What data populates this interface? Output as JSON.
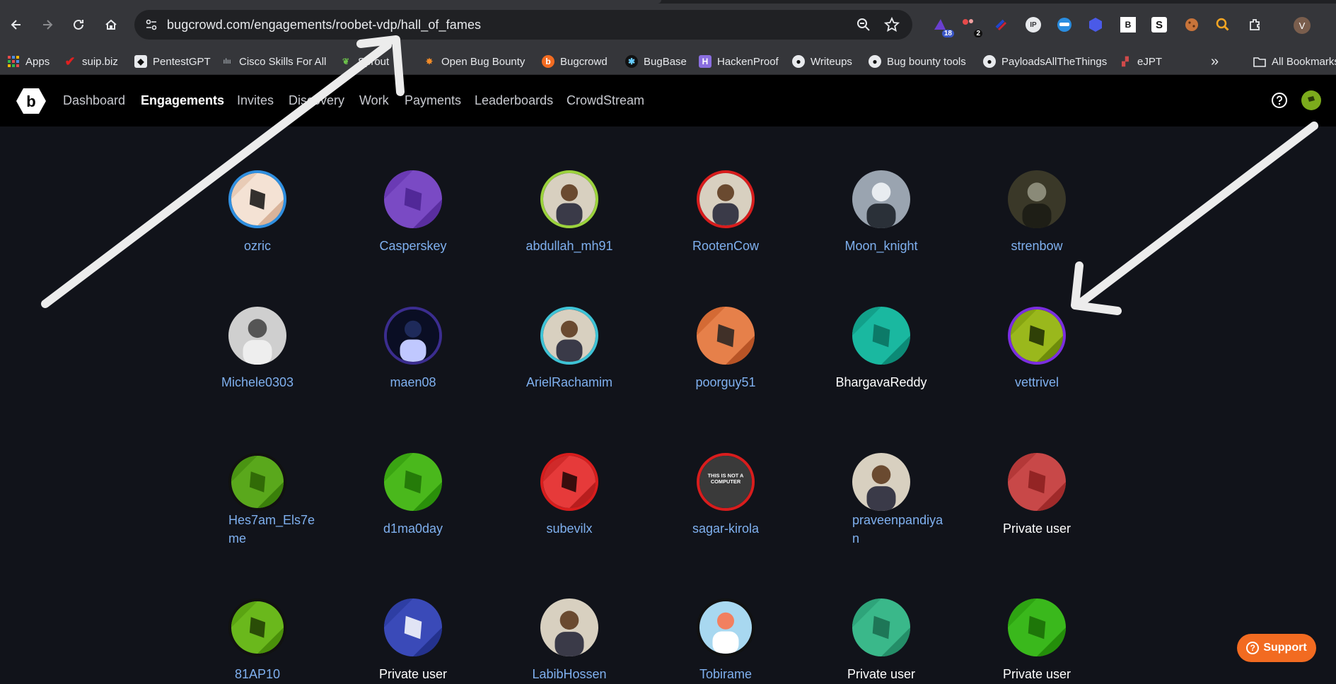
{
  "browser": {
    "url": "bugcrowd.com/engagements/roobet-vdp/hall_of_fames",
    "extension_badges": {
      "ext1": "18",
      "ext2": "2"
    },
    "profile_initial": "V"
  },
  "bookmarks": {
    "items": [
      {
        "label": "Apps",
        "icon": "apps-grid-icon"
      },
      {
        "label": "suip.biz",
        "icon": "red-check-icon"
      },
      {
        "label": "PentestGPT",
        "icon": "shield-icon"
      },
      {
        "label": "Cisco Skills For All",
        "icon": "cisco-icon"
      },
      {
        "label": "Sprout",
        "icon": "sprout-icon"
      },
      {
        "label": "Open Bug Bounty",
        "icon": "bug-icon"
      },
      {
        "label": "Bugcrowd",
        "icon": "bugcrowd-icon"
      },
      {
        "label": "BugBase",
        "icon": "bugbase-icon"
      },
      {
        "label": "HackenProof",
        "icon": "hackenproof-icon"
      },
      {
        "label": "Writeups",
        "icon": "github-icon"
      },
      {
        "label": "Bug bounty tools",
        "icon": "github-icon"
      },
      {
        "label": "PayloadsAllTheThings",
        "icon": "github-icon"
      },
      {
        "label": "eJPT",
        "icon": "ejpt-icon"
      }
    ],
    "overflow": "»",
    "all_bookmarks": "All Bookmarks"
  },
  "nav": {
    "items": [
      "Dashboard",
      "Engagements",
      "Invites",
      "Discovery",
      "Work",
      "Payments",
      "Leaderboards",
      "CrowdStream"
    ],
    "active": "Engagements"
  },
  "hall_of_fame": {
    "rows": [
      [
        {
          "name": "ozric",
          "avatar": "cube-peach",
          "ring": "#2f8fe0"
        },
        {
          "name": "Casperskey",
          "avatar": "cube-purple",
          "ring": ""
        },
        {
          "name": "abdullah_mh91",
          "avatar": "photo-person",
          "ring": "#9bd23c"
        },
        {
          "name": "RootenCow",
          "avatar": "photo-person",
          "ring": "#d81d1d"
        },
        {
          "name": "Moon_knight",
          "avatar": "photo-knight",
          "ring": ""
        },
        {
          "name": "strenbow",
          "avatar": "photo-dark",
          "ring": ""
        }
      ],
      [
        {
          "name": "Michele0303",
          "avatar": "photo-cards",
          "ring": ""
        },
        {
          "name": "maen08",
          "avatar": "photo-night",
          "ring": "#3b2d8f"
        },
        {
          "name": "ArielRachamim",
          "avatar": "photo-person",
          "ring": "#3ec3d6"
        },
        {
          "name": "poorguy51",
          "avatar": "cube-orange",
          "ring": ""
        },
        {
          "name": "BhargavaReddy",
          "avatar": "cube-teal",
          "ring": ""
        },
        {
          "name": "vettrivel",
          "avatar": "cube-olive",
          "ring": "#7b2ee0"
        }
      ],
      [
        {
          "name": "Hes7am_Els7eme",
          "avatar": "cube-green",
          "ring": "#111111"
        },
        {
          "name": "d1ma0day",
          "avatar": "cube-brightgreen",
          "ring": ""
        },
        {
          "name": "subevilx",
          "avatar": "cube-red",
          "ring": "#d81d1d"
        },
        {
          "name": "sagar-kirola",
          "avatar": "photo-text",
          "ring": "#d81d1d"
        },
        {
          "name": "praveenpandiyan",
          "avatar": "photo-person",
          "ring": ""
        },
        {
          "name": "Private user",
          "avatar": "cube-darkred",
          "ring": ""
        }
      ],
      [
        {
          "name": "81AP10",
          "avatar": "cube-green2",
          "ring": "#111111"
        },
        {
          "name": "Private user",
          "avatar": "cube-blue",
          "ring": ""
        },
        {
          "name": "LabibHossen",
          "avatar": "photo-person",
          "ring": ""
        },
        {
          "name": "Tobirame",
          "avatar": "photo-cartoon",
          "ring": "#111111"
        },
        {
          "name": "Private user",
          "avatar": "cube-seagreen",
          "ring": ""
        },
        {
          "name": "Private user",
          "avatar": "cube-lime",
          "ring": ""
        }
      ]
    ],
    "avatar_text": {
      "sagar_kirola": "THIS IS NOT A COMPUTER"
    }
  },
  "support": {
    "label": "Support"
  },
  "colors": {
    "nav_bg": "#000000",
    "page_bg": "#11131a",
    "link": "#7fb0ef",
    "support": "#f26b21"
  }
}
